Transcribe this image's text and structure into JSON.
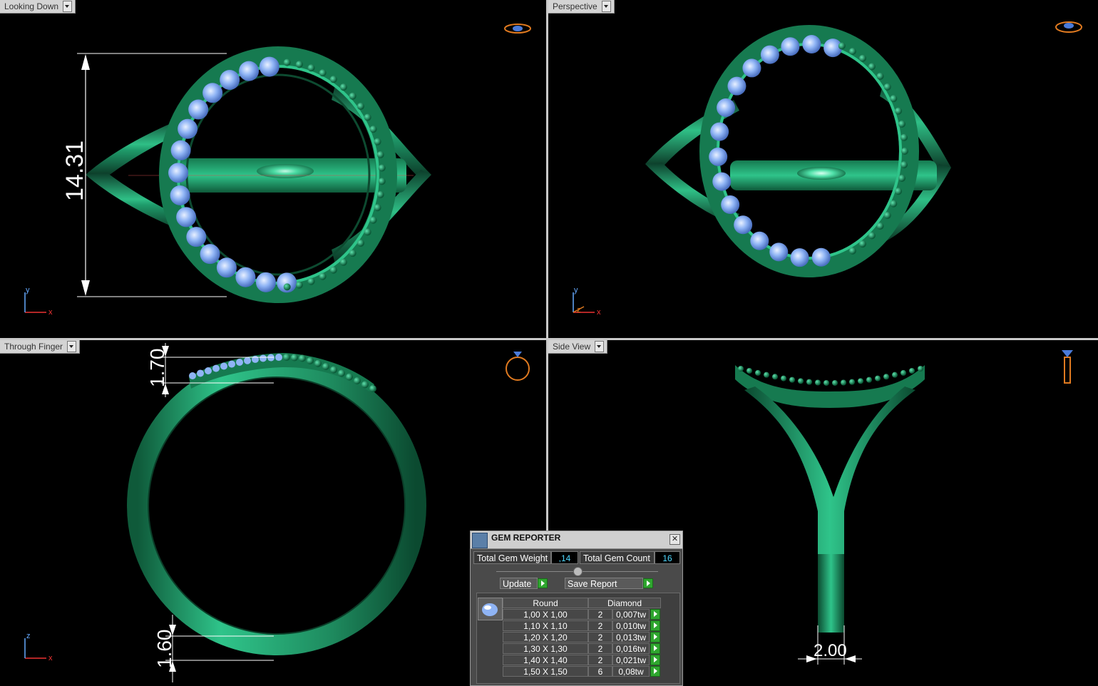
{
  "viewports": {
    "top_left": {
      "label": "Looking Down",
      "dimension": "14.31",
      "axes": [
        "y",
        "x"
      ]
    },
    "top_right": {
      "label": "Perspective",
      "axes": [
        "y",
        "z",
        "x"
      ]
    },
    "bottom_left": {
      "label": "Through Finger",
      "dimension_top": "1.70",
      "dimension_bottom": "1.60",
      "axes": [
        "z",
        "x"
      ]
    },
    "bottom_right": {
      "label": "Side View",
      "dimension": "2.00"
    }
  },
  "gem_reporter": {
    "title": "GEM REPORTER",
    "close_label": "✕",
    "total_weight_label": "Total Gem Weight",
    "total_weight_value": ",14",
    "total_count_label": "Total Gem Count",
    "total_count_value": "16",
    "update_label": "Update",
    "save_label": "Save Report",
    "table": {
      "headers": [
        "Round",
        "Diamond"
      ],
      "rows": [
        {
          "size": "1,00 X 1,00",
          "count": "2",
          "weight": "0,007tw"
        },
        {
          "size": "1,10 X 1,10",
          "count": "2",
          "weight": "0,010tw"
        },
        {
          "size": "1,20 X 1,20",
          "count": "2",
          "weight": "0,013tw"
        },
        {
          "size": "1,30 X 1,30",
          "count": "2",
          "weight": "0,016tw"
        },
        {
          "size": "1,40 X 1,40",
          "count": "2",
          "weight": "0,021tw"
        },
        {
          "size": "1,50 X 1,50",
          "count": "6",
          "weight": "0,08tw"
        }
      ]
    }
  },
  "colors": {
    "metal": "#1e8a5e",
    "metal_highlight": "#7ef0c4",
    "gem": "#8fb4f5",
    "accent_dim": "#ffffff",
    "axis_x": "#e33",
    "axis_y": "#66aaff"
  }
}
